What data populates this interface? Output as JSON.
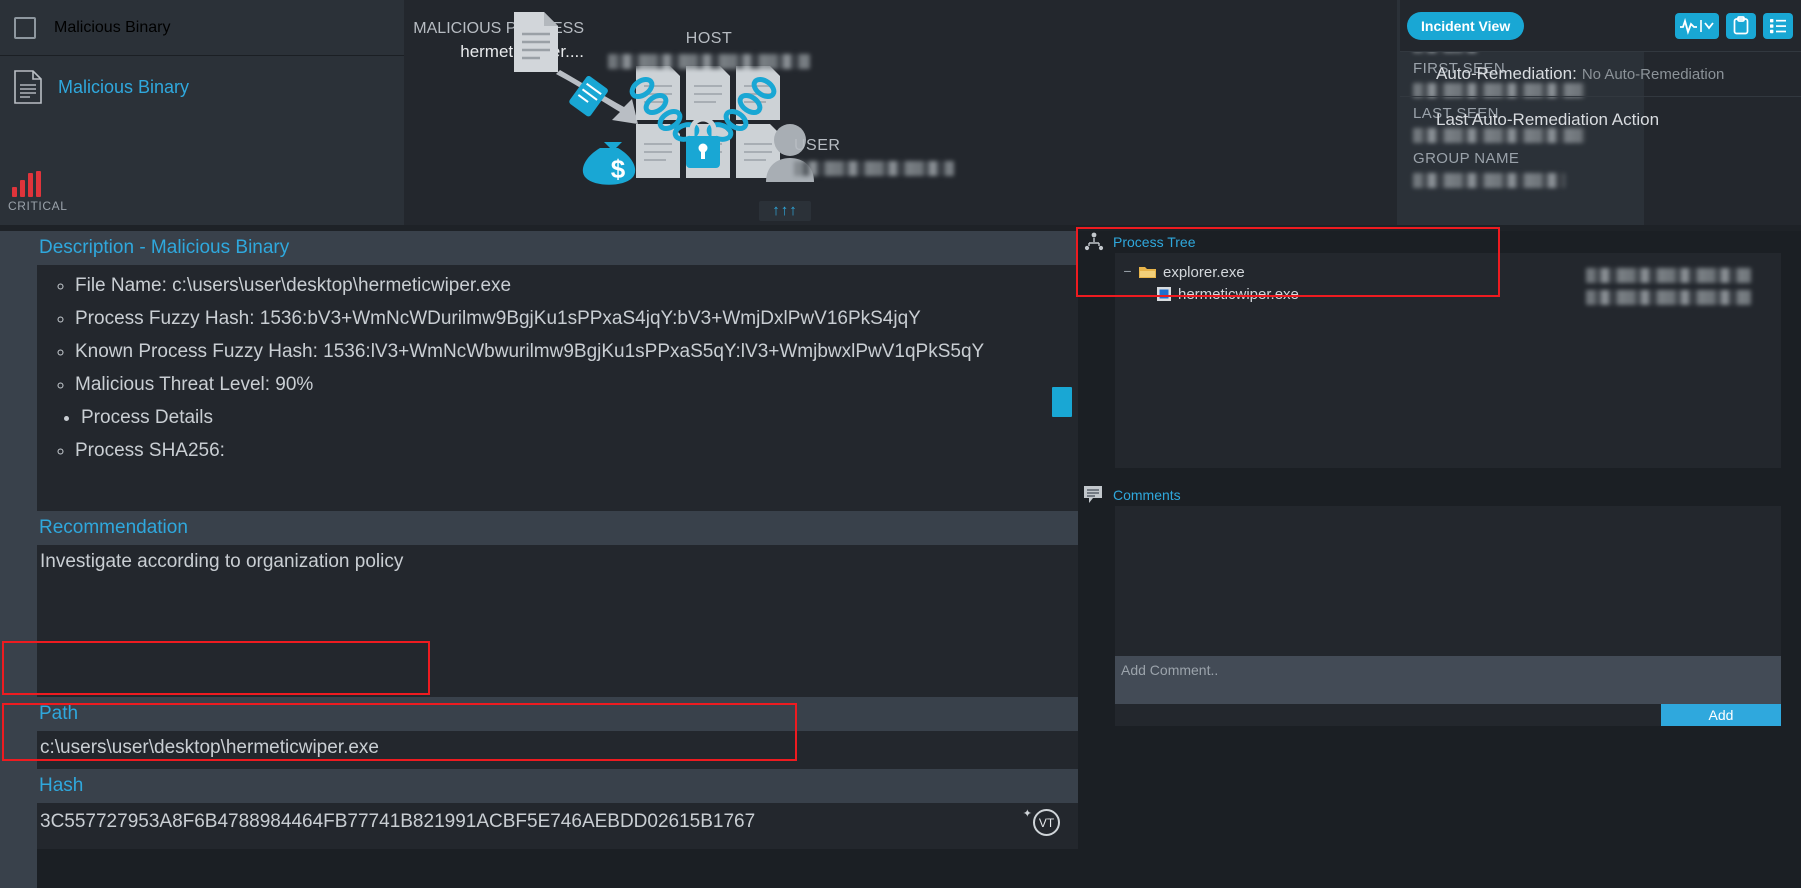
{
  "alert": {
    "title": "Malicious Binary",
    "link_label": "Malicious Binary",
    "severity": "CRITICAL",
    "severity_color": "#e0343b"
  },
  "diagram": {
    "malicious_process_label": "MALICIOUS PROCESS",
    "malicious_process_name": "hermeticwiper....",
    "host_label": "HOST",
    "host_value": "",
    "user_label": "USER",
    "user_value": "",
    "arrows_glyph": "↑↑↑"
  },
  "meta": {
    "alert_id_label": "ALERT ID",
    "alert_id_value": "",
    "first_seen_label": "FIRST SEEN",
    "first_seen_value": "",
    "last_seen_label": "LAST SEEN",
    "last_seen_value": "",
    "group_name_label": "GROUP NAME",
    "group_name_value": ""
  },
  "toolbar": {
    "incident_view_label": "Incident View",
    "activity_icon": "activity-chart-icon",
    "clipboard_icon": "clipboard-icon",
    "list_icon": "list-icon",
    "accent_color": "#19a7d4"
  },
  "remediation": {
    "label": "Auto-Remediation:",
    "status": "No Auto-Remediation",
    "last_action_label": "Last Auto-Remediation Action"
  },
  "description": {
    "title": "Description - Malicious Binary",
    "items": [
      "File Name: c:\\users\\user\\desktop\\hermeticwiper.exe",
      "Process Fuzzy Hash: 1536:bV3+WmNcWDurilmw9BgjKu1sPPxaS4jqY:bV3+WmjDxlPwV16PkS4jqY",
      "Known Process Fuzzy Hash: 1536:lV3+WmNcWbwurilmw9BgjKu1sPPxaS5qY:lV3+WmjbwxlPwV1qPkS5qY",
      "Malicious Threat Level: 90%"
    ],
    "group_label": "Process Details",
    "group_items": [
      "Process SHA256:"
    ]
  },
  "recommendation": {
    "title": "Recommendation",
    "text": "Investigate according to organization policy"
  },
  "path": {
    "title": "Path",
    "value": "c:\\users\\user\\desktop\\hermeticwiper.exe"
  },
  "hash": {
    "title": "Hash",
    "value": "3C557727953A8F6B4788984464FB77741B821991ACBF5E746AEBDD02615B1767",
    "vt_label": "VT"
  },
  "process_tree": {
    "title": "Process Tree",
    "nodes": [
      {
        "name": "explorer.exe",
        "expander": "−",
        "timestamp": ""
      },
      {
        "name": "hermeticwiper.exe",
        "expander": "",
        "timestamp": ""
      }
    ]
  },
  "comments": {
    "title": "Comments",
    "placeholder": "Add Comment..",
    "add_label": "Add"
  },
  "annotations": {
    "highlight_color": "#ee1b20"
  }
}
